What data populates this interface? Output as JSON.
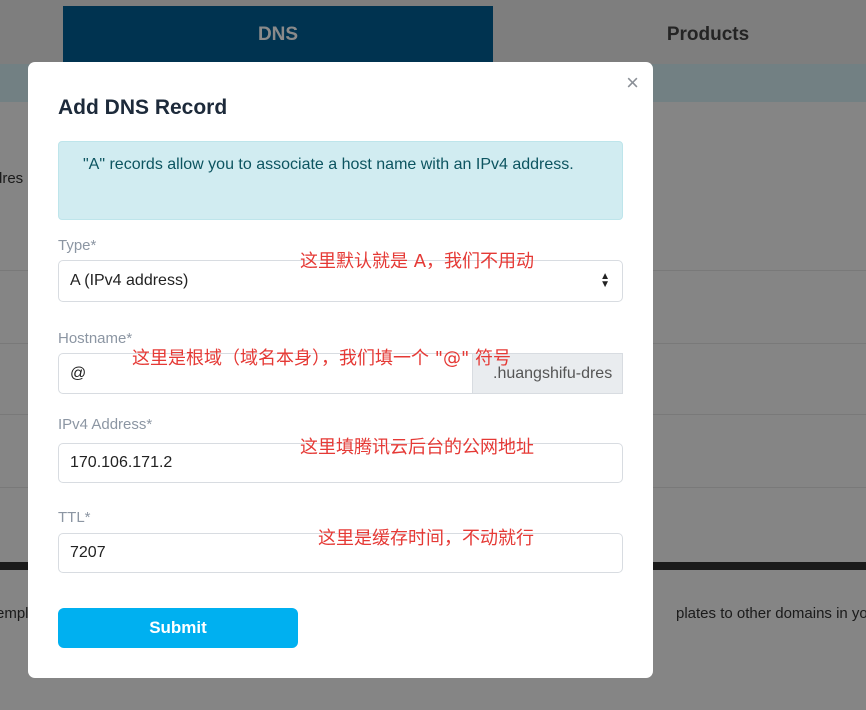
{
  "background": {
    "tabs": [
      {
        "label": "DNS",
        "active": true
      },
      {
        "label": "Products",
        "active": false
      }
    ],
    "left_text": "dres",
    "footer_left": "empl",
    "footer_right": "plates to other domains in yo"
  },
  "modal": {
    "title": "Add DNS Record",
    "close_symbol": "×",
    "info": "\"A\" records allow you to associate a host name with an IPv4 address.",
    "type": {
      "label": "Type*",
      "value": "A (IPv4 address)"
    },
    "hostname": {
      "label": "Hostname*",
      "value": "@",
      "suffix": ".huangshifu-dres"
    },
    "ipv4": {
      "label": "IPv4 Address*",
      "value": "170.106.171.2"
    },
    "ttl": {
      "label": "TTL*",
      "value": "7207"
    },
    "submit_label": "Submit"
  },
  "annotations": {
    "type_note": "这里默认就是 A，我们不用动",
    "hostname_note": "这里是根域（域名本身），我们填一个 \"@\" 符号",
    "ipv4_note": "这里填腾讯云后台的公网地址",
    "ttl_note": "这里是缓存时间，不动就行"
  },
  "colors": {
    "tab_active": "#005f94",
    "submit": "#00b0f0",
    "info_bg": "#d1ecf1",
    "annotation": "#e53935"
  }
}
